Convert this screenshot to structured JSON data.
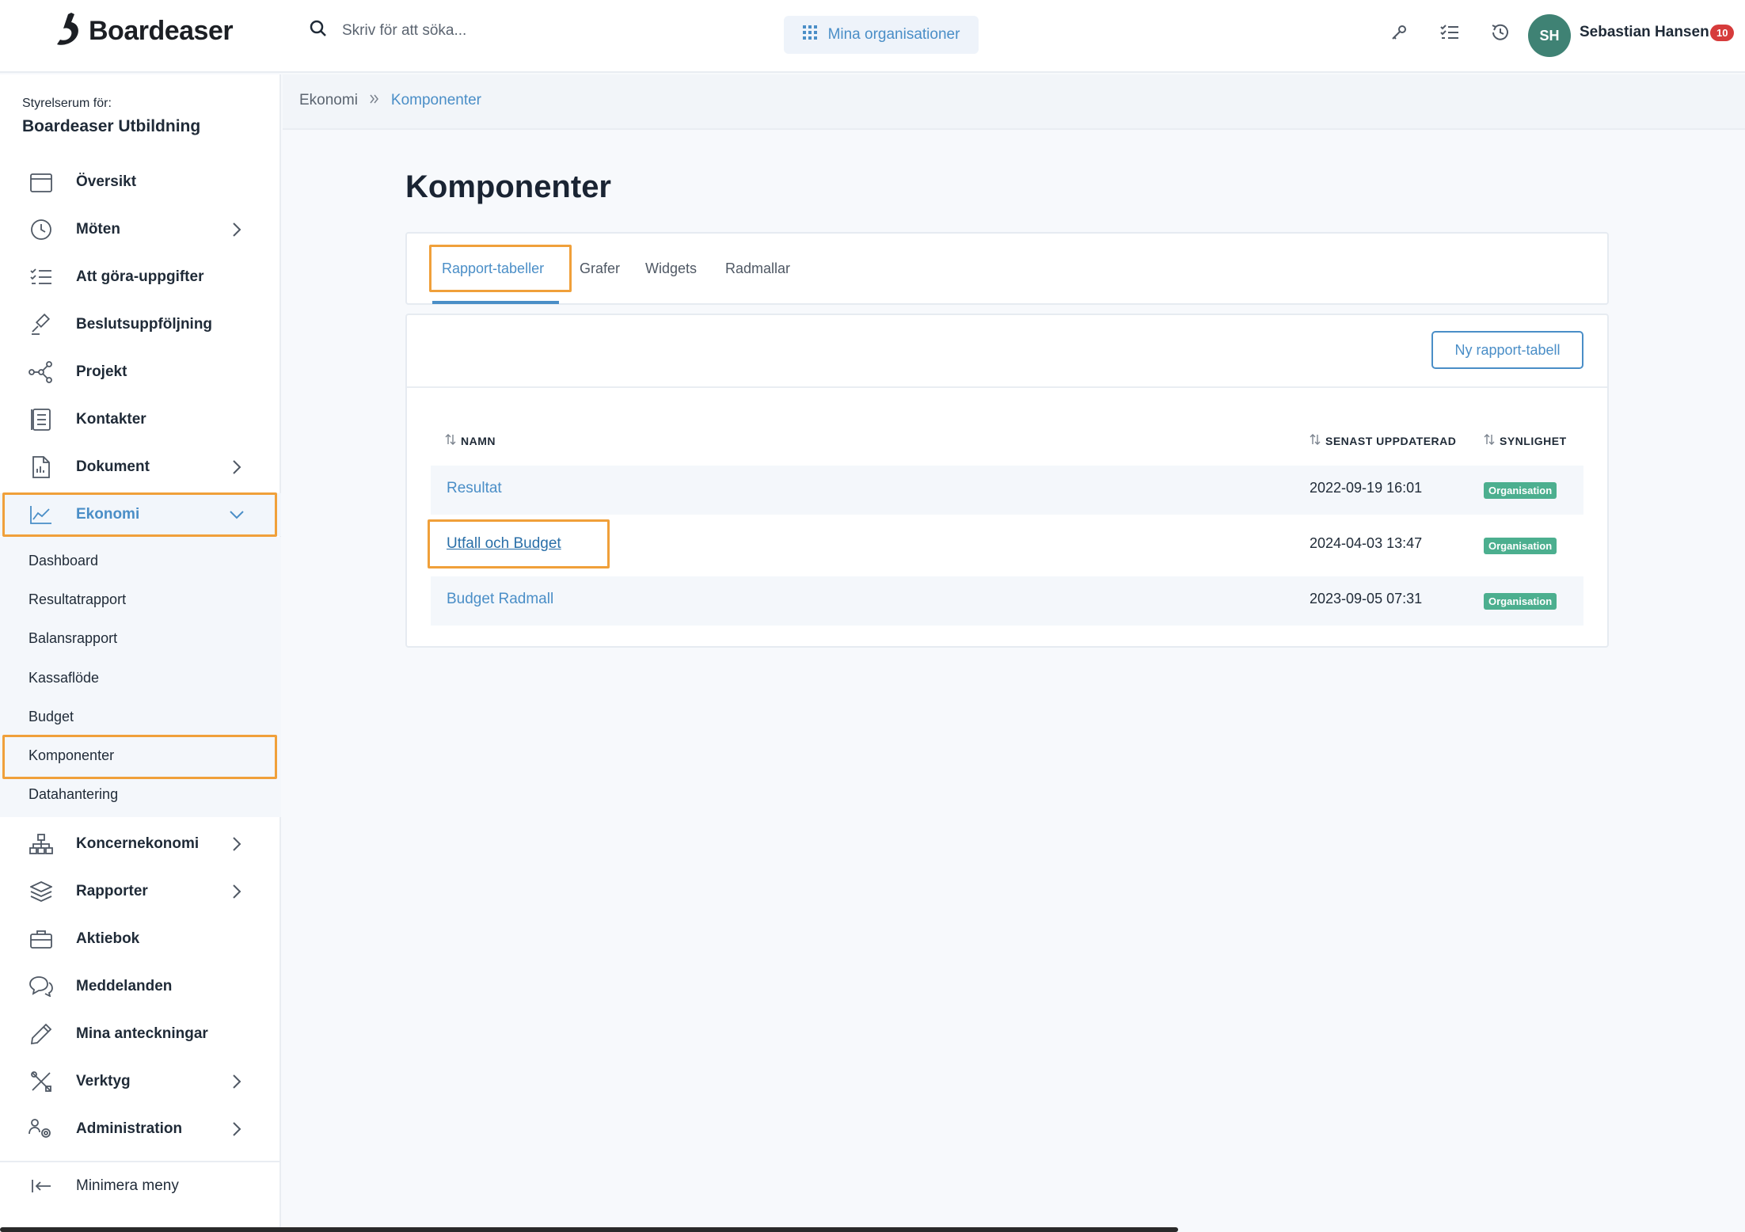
{
  "brand": {
    "name": "Boardeaser"
  },
  "header": {
    "search_placeholder": "Skriv för att söka...",
    "org_button": "Mina organisationer",
    "icons": [
      "key-icon",
      "checklist-icon",
      "history-icon"
    ],
    "user": {
      "initials": "SH",
      "name": "Sebastian Hansen",
      "notifications": "10"
    }
  },
  "sidebar": {
    "org_label": "Styrelserum för:",
    "org_name": "Boardeaser Utbildning",
    "items": [
      {
        "label": "Översikt",
        "icon": "calendar-icon",
        "chevron": false
      },
      {
        "label": "Möten",
        "icon": "clock-icon",
        "chevron": true
      },
      {
        "label": "Att göra-uppgifter",
        "icon": "checklist-icon",
        "chevron": false
      },
      {
        "label": "Beslutsuppföljning",
        "icon": "gavel-icon",
        "chevron": false
      },
      {
        "label": "Projekt",
        "icon": "network-icon",
        "chevron": false
      },
      {
        "label": "Kontakter",
        "icon": "contacts-icon",
        "chevron": false
      },
      {
        "label": "Dokument",
        "icon": "document-icon",
        "chevron": true
      },
      {
        "label": "Ekonomi",
        "icon": "chart-line-icon",
        "chevron": true,
        "active": true
      }
    ],
    "sub_items": [
      "Dashboard",
      "Resultatrapport",
      "Balansrapport",
      "Kassaflöde",
      "Budget",
      "Komponenter",
      "Datahantering"
    ],
    "items_after": [
      {
        "label": "Koncernekonomi",
        "icon": "hierarchy-icon",
        "chevron": true
      },
      {
        "label": "Rapporter",
        "icon": "layers-icon",
        "chevron": true
      },
      {
        "label": "Aktiebok",
        "icon": "briefcase-icon",
        "chevron": false
      },
      {
        "label": "Meddelanden",
        "icon": "chat-icon",
        "chevron": false
      },
      {
        "label": "Mina anteckningar",
        "icon": "pencil-icon",
        "chevron": false
      },
      {
        "label": "Verktyg",
        "icon": "tools-icon",
        "chevron": true
      },
      {
        "label": "Administration",
        "icon": "users-gear-icon",
        "chevron": true
      }
    ],
    "minimize": "Minimera meny"
  },
  "breadcrumb": {
    "parent": "Ekonomi",
    "current": "Komponenter"
  },
  "page": {
    "title": "Komponenter",
    "tabs": [
      "Rapport-tabeller",
      "Grafer",
      "Widgets",
      "Radmallar"
    ],
    "new_button": "Ny rapport-tabell",
    "columns": {
      "name": "NAMN",
      "updated": "SENAST UPPDATERAD",
      "visibility": "SYNLIGHET"
    },
    "rows": [
      {
        "name": "Resultat",
        "updated": "2022-09-19 16:01",
        "visibility": "Organisation"
      },
      {
        "name": "Utfall och Budget",
        "updated": "2024-04-03 13:47",
        "visibility": "Organisation"
      },
      {
        "name": "Budget Radmall",
        "updated": "2023-09-05 07:31",
        "visibility": "Organisation"
      }
    ]
  },
  "colors": {
    "accent": "#4a8ec7",
    "highlight": "#f0a03a",
    "badge": "#4caf8f",
    "avatar": "#3f8274"
  }
}
